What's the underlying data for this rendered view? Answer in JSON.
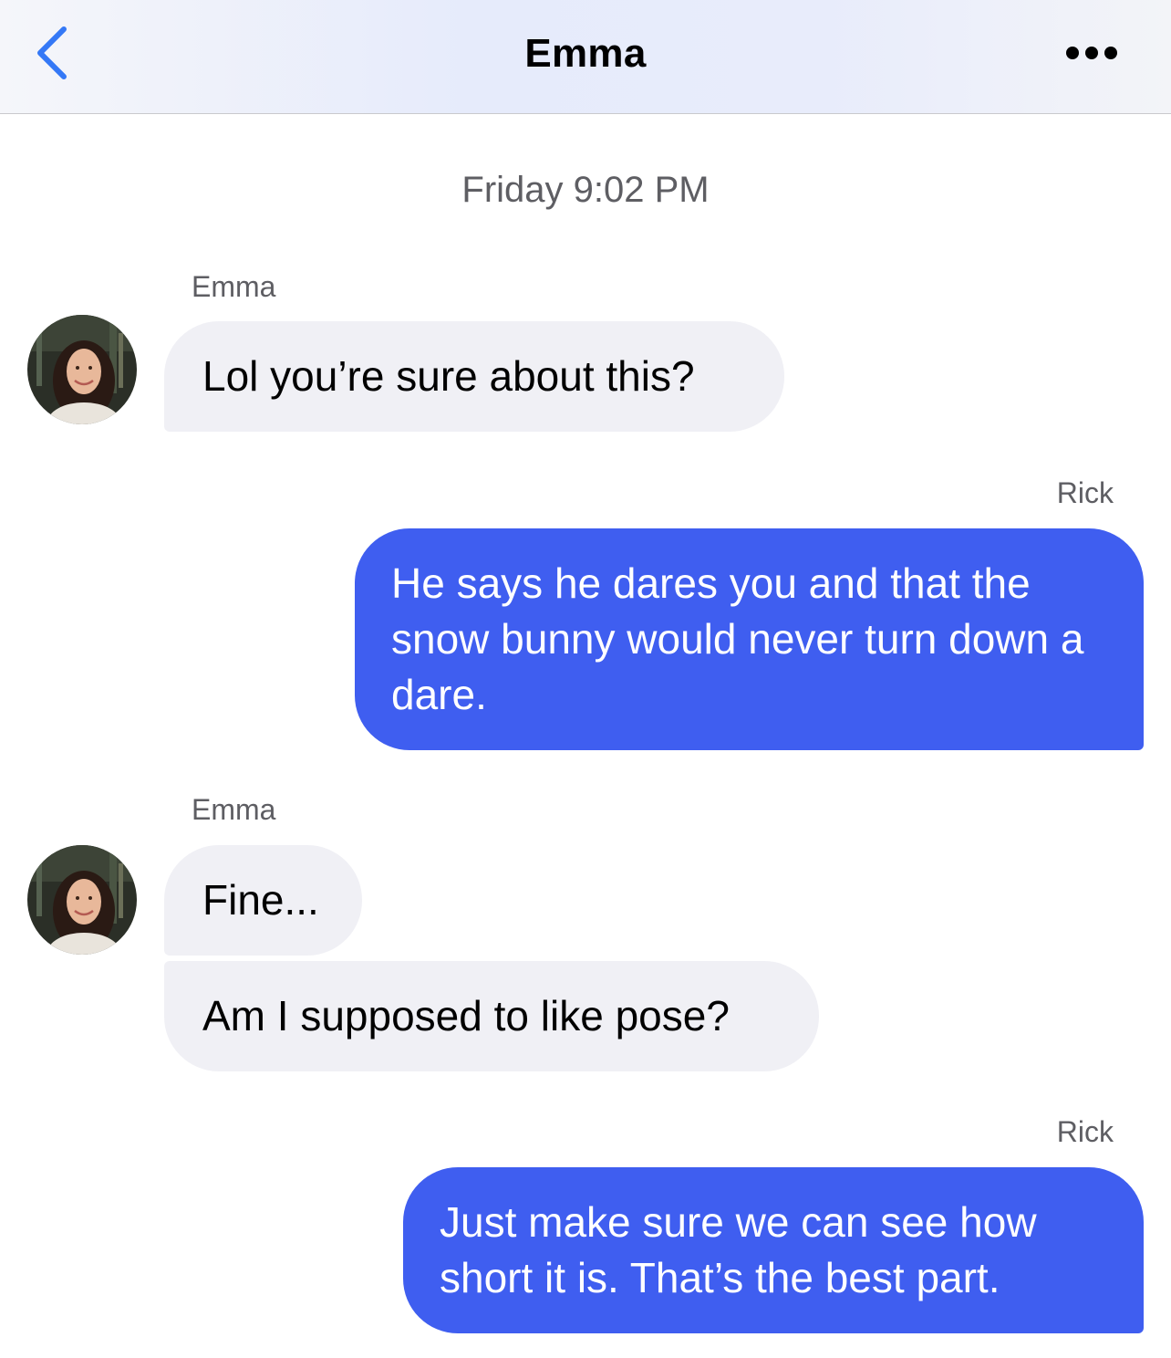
{
  "header": {
    "title": "Emma",
    "back_icon": "chevron-left-icon",
    "more_icon": "ellipsis-icon",
    "accent_color": "#3478f6"
  },
  "conversation": {
    "timestamp": "Friday 9:02 PM",
    "messages": [
      {
        "sender": "Emma",
        "direction": "incoming",
        "text": "Lol you’re sure about this?"
      },
      {
        "sender": "Rick",
        "direction": "outgoing",
        "text": "He says he dares you and that the snow bunny would never turn down a dare."
      },
      {
        "sender": "Emma",
        "direction": "incoming",
        "text": "Fine..."
      },
      {
        "sender": "Emma",
        "direction": "incoming",
        "text": "Am I supposed to like pose?"
      },
      {
        "sender": "Rick",
        "direction": "outgoing",
        "text": "Just make sure we can see how short it is. That’s the best part."
      }
    ]
  },
  "colors": {
    "incoming_bubble": "#f0f0f5",
    "outgoing_bubble": "#3f5ef0",
    "meta_text": "#5e5e63"
  }
}
